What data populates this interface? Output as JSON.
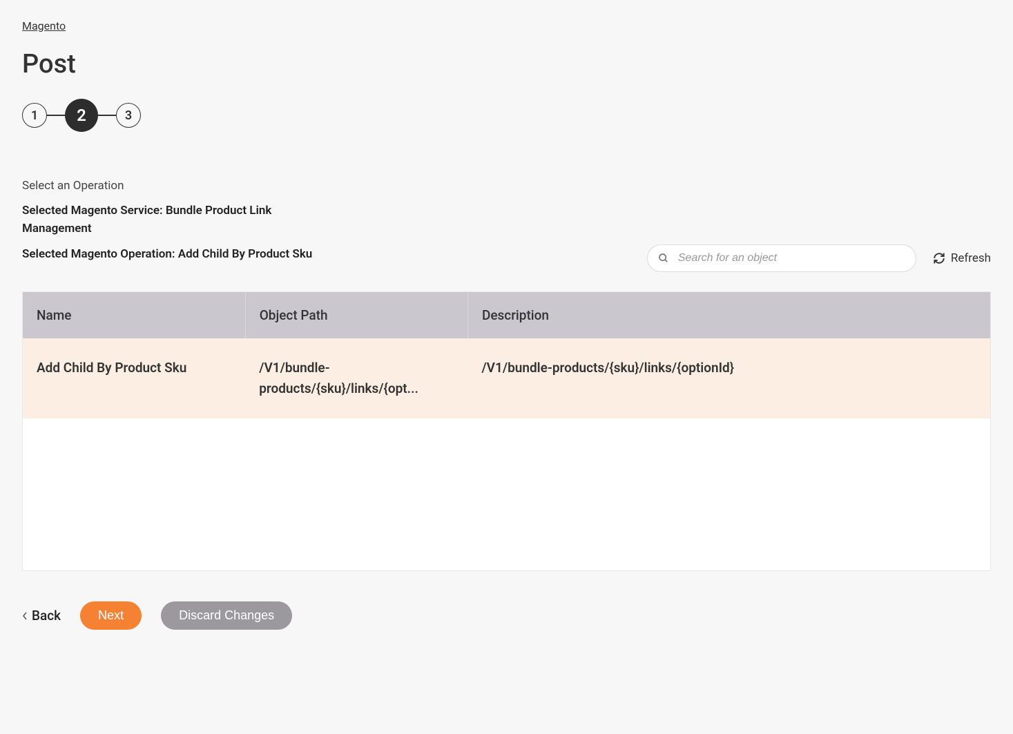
{
  "breadcrumb": "Magento",
  "page_title": "Post",
  "stepper": {
    "steps": [
      "1",
      "2",
      "3"
    ],
    "active_index": 1
  },
  "section": {
    "label": "Select an Operation",
    "selected_service": "Selected Magento Service: Bundle Product Link Management",
    "selected_operation": "Selected Magento Operation: Add Child By Product Sku"
  },
  "search": {
    "placeholder": "Search for an object"
  },
  "refresh_label": "Refresh",
  "table": {
    "headers": {
      "name": "Name",
      "object_path": "Object Path",
      "description": "Description"
    },
    "rows": [
      {
        "name": "Add Child By Product Sku",
        "object_path": "/V1/bundle-products/{sku}/links/{opt...",
        "description": "/V1/bundle-products/{sku}/links/{optionId}"
      }
    ]
  },
  "footer": {
    "back": "Back",
    "next": "Next",
    "discard": "Discard Changes"
  }
}
